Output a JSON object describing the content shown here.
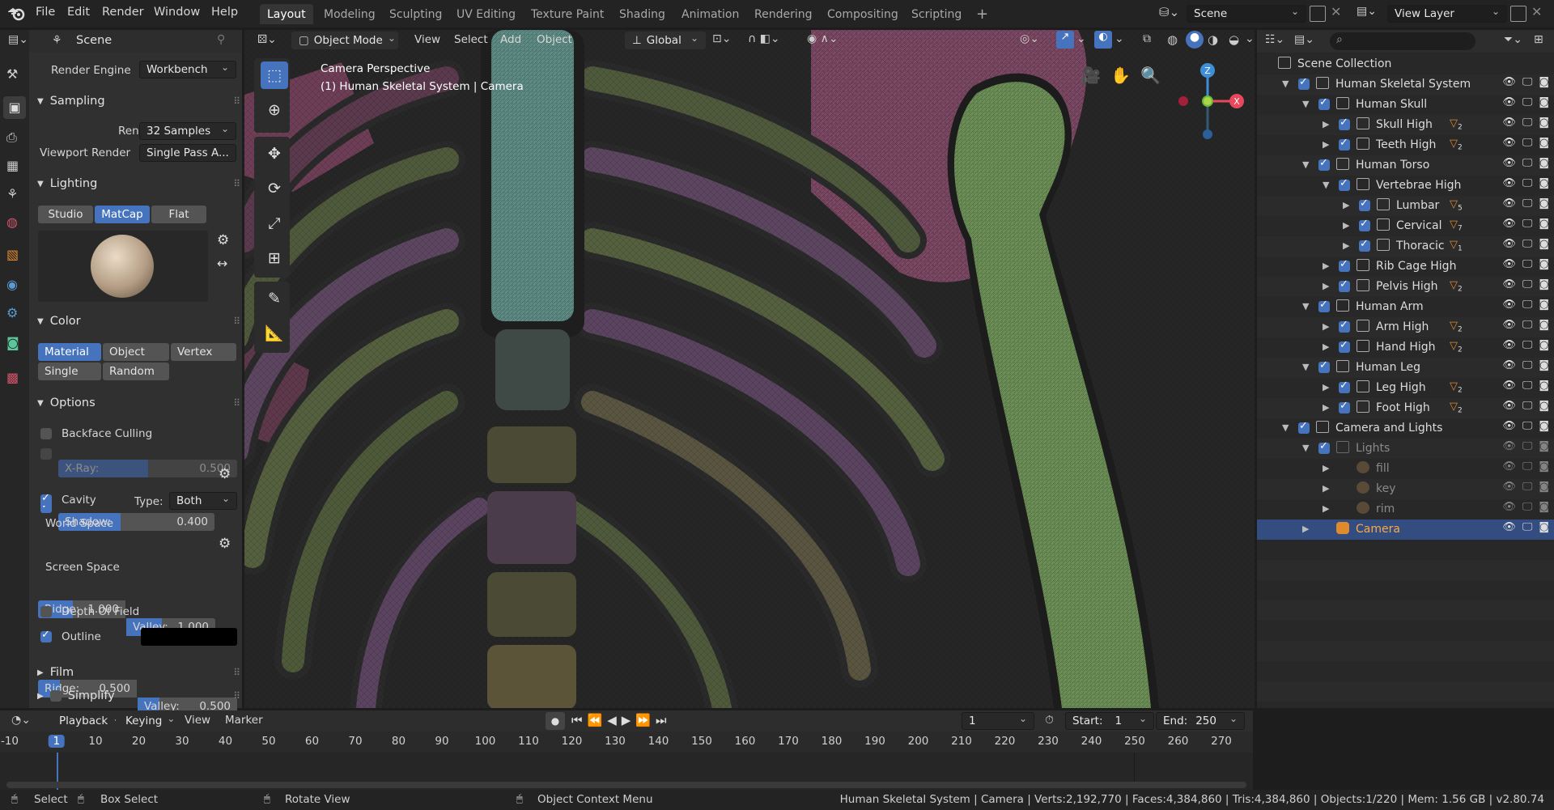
{
  "topbar": {
    "menus": [
      "File",
      "Edit",
      "Render",
      "Window",
      "Help"
    ],
    "workspaces": [
      "Layout",
      "Modeling",
      "Sculpting",
      "UV Editing",
      "Texture Paint",
      "Shading",
      "Animation",
      "Rendering",
      "Compositing",
      "Scripting"
    ],
    "active_workspace": "Layout",
    "add_tab": "+",
    "scene": "Scene",
    "view_layer": "View Layer"
  },
  "properties": {
    "context": "Scene",
    "render_engine_label": "Render Engine",
    "render_engine": "Workbench",
    "sampling": {
      "title": "Sampling",
      "render_label": "Render",
      "render_value": "32 Samples",
      "viewport_label": "Viewport Render",
      "viewport_value": "Single Pass A..."
    },
    "lighting": {
      "title": "Lighting",
      "modes": [
        "Studio",
        "MatCap",
        "Flat"
      ],
      "active": "MatCap"
    },
    "color": {
      "title": "Color",
      "modes": [
        "Material",
        "Object",
        "Vertex",
        "Single",
        "Random"
      ],
      "active": "Material"
    },
    "options": {
      "title": "Options",
      "backface": "Backface Culling",
      "xray_label": "X-Ray:",
      "xray_value": "0.500",
      "xray_fraction": 0.5,
      "shadow_label": "Shadow:",
      "shadow_value": "0.400",
      "shadow_fraction": 0.4,
      "cavity": "Cavity",
      "type_label": "Type:",
      "type_value": "Both",
      "world_space": "World Space",
      "ws_ridge_label": "Ridge:",
      "ws_ridge_value": "1.000",
      "ws_valley_label": "Valley:",
      "ws_valley_value": "1.000",
      "screen_space": "Screen Space",
      "ss_ridge_label": "Ridge:",
      "ss_ridge_value": "0.500",
      "ss_valley_label": "Valley:",
      "ss_valley_value": "0.500",
      "dof": "Depth Of Field",
      "outline": "Outline",
      "outline_color": "#000000"
    },
    "film": "Film",
    "simplify": "Simplify"
  },
  "viewport": {
    "mode": "Object Mode",
    "menus": [
      "View",
      "Select",
      "Add",
      "Object"
    ],
    "orientation": "Global",
    "overlay_title": "Camera Perspective",
    "overlay_sub": "(1) Human Skeletal System | Camera",
    "axes": {
      "z": "Z",
      "x": "X"
    }
  },
  "outliner": {
    "search_placeholder": "",
    "rows": [
      {
        "name": "Scene Collection",
        "depth": 0,
        "kind": "scene"
      },
      {
        "name": "Human Skeletal System",
        "depth": 1,
        "kind": "coll",
        "open": true
      },
      {
        "name": "Human Skull",
        "depth": 2,
        "kind": "coll",
        "open": true
      },
      {
        "name": "Skull High",
        "depth": 3,
        "kind": "coll",
        "badge": "2"
      },
      {
        "name": "Teeth High",
        "depth": 3,
        "kind": "coll",
        "badge": "2"
      },
      {
        "name": "Human Torso",
        "depth": 2,
        "kind": "coll",
        "open": true
      },
      {
        "name": "Vertebrae High",
        "depth": 3,
        "kind": "coll",
        "open": true
      },
      {
        "name": "Lumbar",
        "depth": 4,
        "kind": "coll",
        "badge": "5"
      },
      {
        "name": "Cervical",
        "depth": 4,
        "kind": "coll",
        "badge": "7"
      },
      {
        "name": "Thoracic",
        "depth": 4,
        "kind": "coll",
        "badge": "1"
      },
      {
        "name": "Rib Cage High",
        "depth": 3,
        "kind": "coll"
      },
      {
        "name": "Pelvis High",
        "depth": 3,
        "kind": "coll",
        "badge": "2"
      },
      {
        "name": "Human Arm",
        "depth": 2,
        "kind": "coll",
        "open": true
      },
      {
        "name": "Arm High",
        "depth": 3,
        "kind": "coll",
        "badge": "2"
      },
      {
        "name": "Hand High",
        "depth": 3,
        "kind": "coll",
        "badge": "2"
      },
      {
        "name": "Human Leg",
        "depth": 2,
        "kind": "coll",
        "open": true
      },
      {
        "name": "Leg High",
        "depth": 3,
        "kind": "coll",
        "badge": "2"
      },
      {
        "name": "Foot High",
        "depth": 3,
        "kind": "coll",
        "badge": "2"
      },
      {
        "name": "Camera and Lights",
        "depth": 1,
        "kind": "coll",
        "open": true
      },
      {
        "name": "Lights",
        "depth": 2,
        "kind": "coll",
        "open": true,
        "dim": true
      },
      {
        "name": "fill",
        "depth": 3,
        "kind": "light",
        "dim": true
      },
      {
        "name": "key",
        "depth": 3,
        "kind": "light",
        "dim": true
      },
      {
        "name": "rim",
        "depth": 3,
        "kind": "light",
        "dim": true
      },
      {
        "name": "Camera",
        "depth": 2,
        "kind": "camera",
        "selected": true
      }
    ]
  },
  "timeline": {
    "menus": [
      "Playback",
      "Keying",
      "View",
      "Marker"
    ],
    "current_frame": "1",
    "start_label": "Start:",
    "start": "1",
    "end_label": "End:",
    "end": "250",
    "ruler": [
      "-10",
      "1",
      "10",
      "20",
      "30",
      "40",
      "50",
      "60",
      "70",
      "80",
      "90",
      "100",
      "110",
      "120",
      "130",
      "140",
      "150",
      "160",
      "170",
      "180",
      "190",
      "200",
      "210",
      "220",
      "230",
      "240",
      "250",
      "260",
      "270"
    ]
  },
  "status": {
    "select": "Select",
    "box_select": "Box Select",
    "rotate": "Rotate View",
    "context_menu": "Object Context Menu",
    "info": "Human Skeletal System | Camera | Verts:2,192,770 | Faces:4,384,860 | Tris:4,384,860 | Objects:1/220 | Mem: 1.56 GB | v2.80.74"
  },
  "colors": {
    "accent": "#4673bd",
    "selected_row": "#334d80",
    "orange": "#e08a2e"
  }
}
